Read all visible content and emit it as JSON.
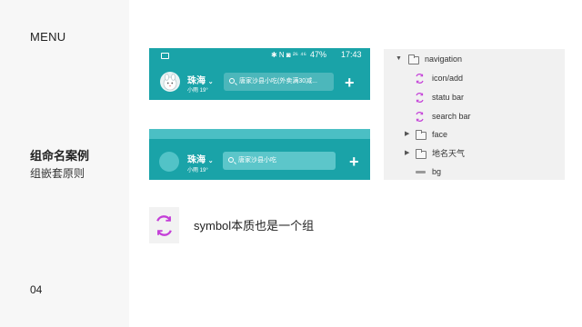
{
  "sidebar": {
    "menu": "MENU",
    "title": "组命名案例",
    "subtitle": "组嵌套原则",
    "page_number": "04"
  },
  "mock1": {
    "status_icons": "✱ N ◙ ²⁶ ⁴⁶",
    "battery": "47%",
    "time": "17:43",
    "city": "珠海",
    "weather": "小雨 19°",
    "search_text": "唐家沙县小吃(外卖满30减...",
    "plus": "+"
  },
  "mock2": {
    "city": "珠海",
    "weather": "小雨 19°",
    "search_text": "唐家沙县小吃",
    "plus": "+"
  },
  "layer_tree": {
    "items": [
      {
        "label": "navigation",
        "type": "folder",
        "expanded": true
      },
      {
        "label": "icon/add",
        "type": "symbol"
      },
      {
        "label": "statu bar",
        "type": "symbol"
      },
      {
        "label": "search bar",
        "type": "symbol"
      },
      {
        "label": "face",
        "type": "folder",
        "expanded": false
      },
      {
        "label": "地名天气",
        "type": "folder",
        "expanded": false
      },
      {
        "label": "bg",
        "type": "shape"
      }
    ]
  },
  "note": {
    "text": "symbol本质也是一个组"
  },
  "colors": {
    "teal": "#1aa3a8",
    "teal_light": "#4bbfc4",
    "symbol_purple": "#c43fd8"
  }
}
